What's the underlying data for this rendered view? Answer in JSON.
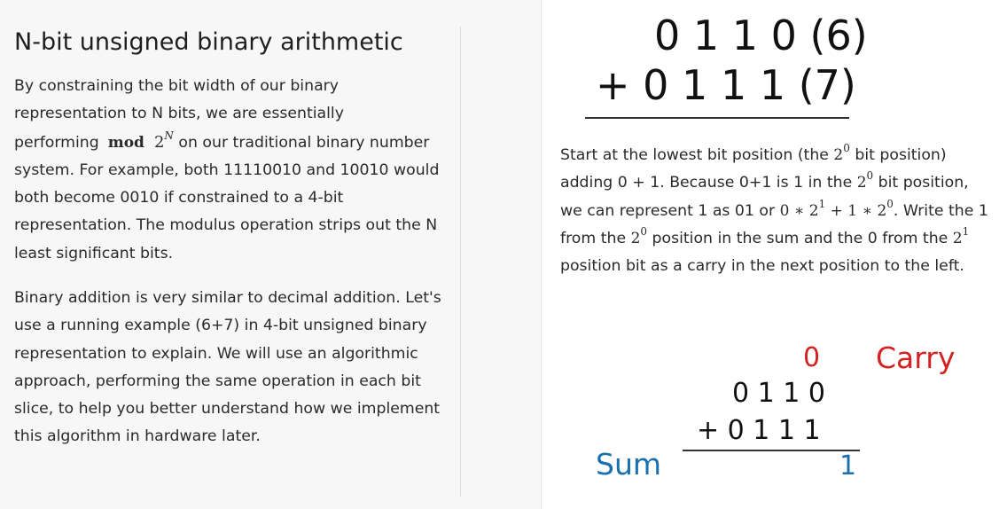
{
  "left": {
    "heading": "N-bit unsigned binary arithmetic",
    "p1": {
      "before_math": "By constraining the bit width of our binary representation to N bits, we are essentially performing",
      "math_op": "mod",
      "math_base": "2",
      "math_exp": "N",
      "after_math": " on our traditional binary number system. For example, both 11110010 and 10010 would both become 0010 if constrained to a 4-bit representation. The modulus operation strips out the N least significant bits."
    },
    "p2": "Binary addition is very similar to decimal addition. Let's use a running example (6+7) in 4-bit unsigned binary representation to explain. We will use an algorithmic approach, performing the same operation in each bit slice, to help you better understand how we implement this algorithm in hardware later."
  },
  "top_calc": {
    "row1": "0 1 1 0 (6)",
    "row2": "+ 0 1 1 1 (7)"
  },
  "right": {
    "t1": "Start at the lowest bit position (the ",
    "m1_base": "2",
    "m1_exp": "0",
    "t2": " bit position) adding 0 + 1. Because 0+1 is 1 in the ",
    "m2_base": "2",
    "m2_exp": "0",
    "t3": " bit position, we can represent 1 as 01 or ",
    "m3_a": "0 ∗ 2",
    "m3_a_exp": "1",
    "m3_b": " + 1 ∗ 2",
    "m3_b_exp": "0",
    "t4": ". Write the 1 from the ",
    "m4_base": "2",
    "m4_exp": "0",
    "t5": " position in the sum and the 0 from the ",
    "m5_base": "2",
    "m5_exp": "1",
    "t6": " position bit as a carry in the next position to the left."
  },
  "bottom_calc": {
    "carry_digit": "0",
    "carry_label": "Carry",
    "row1": "0 1 1 0",
    "row2": "+ 0 1 1 1",
    "sum_label": "Sum",
    "sum_digit": "1",
    "colors": {
      "carry": "#d32222",
      "sum": "#1a6fae"
    }
  }
}
